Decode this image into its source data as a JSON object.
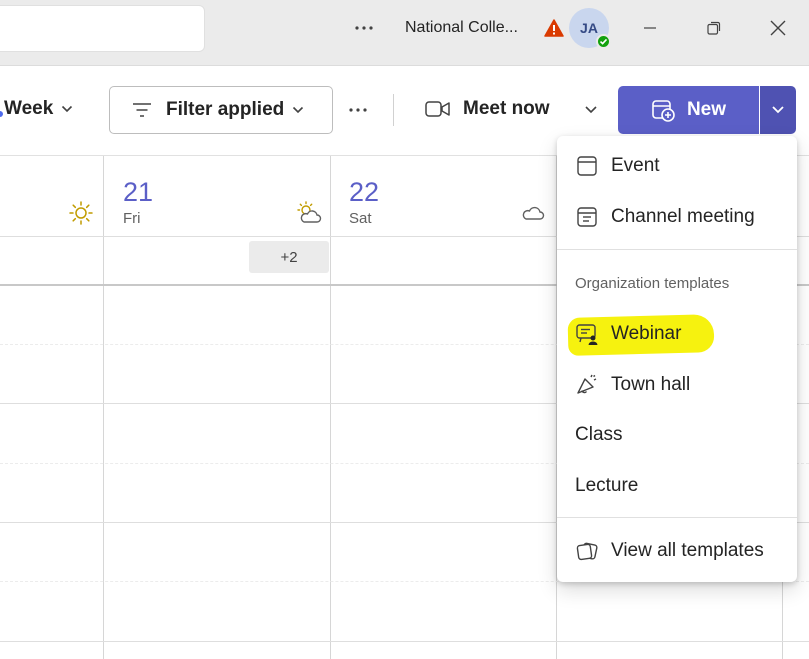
{
  "titlebar": {
    "org_name": "National Colle...",
    "avatar_initials": "JA",
    "presence": "available",
    "more_icon": "ellipsis-icon",
    "warning_icon": "warning-icon"
  },
  "toolbar": {
    "view_label": "Week",
    "filter_label": "Filter applied",
    "meet_now_label": "Meet now",
    "new_label": "New"
  },
  "calendar": {
    "days": [
      {
        "num": "21",
        "name": "Fri",
        "weather_icon": "partly-sunny-icon"
      },
      {
        "num": "22",
        "name": "Sat",
        "weather_icon": "cloud-icon"
      }
    ],
    "prev_day_weather_icon": "sun-icon",
    "more_events": "+2"
  },
  "menu": {
    "items": [
      {
        "label": "Event",
        "icon": "calendar-icon"
      },
      {
        "label": "Channel meeting",
        "icon": "channel-calendar-icon"
      }
    ],
    "heading": "Organization templates",
    "templates": [
      {
        "label": "Webinar",
        "icon": "webinar-icon"
      },
      {
        "label": "Town hall",
        "icon": "megaphone-icon"
      },
      {
        "label": "Class"
      },
      {
        "label": "Lecture"
      }
    ],
    "view_all_label": "View all templates",
    "view_all_icon": "templates-icon"
  },
  "colors": {
    "accent": "#5b5fc7",
    "accent_dark": "#4f52b2",
    "highlight": "#f6f20f",
    "warning": "#da3b01",
    "presence": "#13a10e"
  }
}
